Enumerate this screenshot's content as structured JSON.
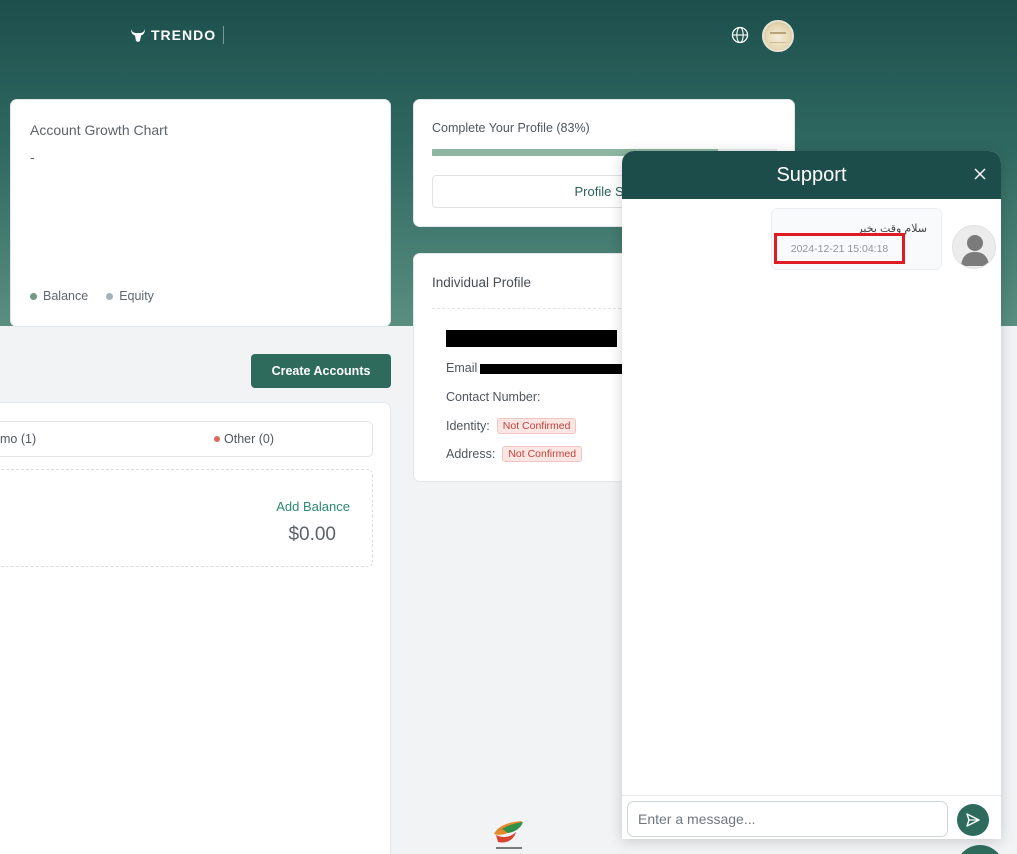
{
  "header": {
    "brand": "TRENDO"
  },
  "growth_chart": {
    "title": "Account Growth Chart",
    "value": "-",
    "legend": [
      {
        "label": "Balance",
        "color": "#6f9a86"
      },
      {
        "label": "Equity",
        "color": "#a7b2b6"
      }
    ]
  },
  "profile_completion": {
    "title": "Complete Your Profile (83%)",
    "percent": 83,
    "button_label": "Profile Set"
  },
  "individual_profile": {
    "title": "Individual Profile",
    "email_label": "Email",
    "contact_label": "Contact Number:",
    "identity_label": "Identity:",
    "identity_status": "Not Confirmed",
    "address_label": "Address:",
    "address_status": "Not Confirmed"
  },
  "accounts": {
    "create_button": "Create Accounts",
    "filter_demo": "mo (1)",
    "filter_other": "Other (0)",
    "add_balance": "Add Balance",
    "balance": "$0.00"
  },
  "support": {
    "title": "Support",
    "message_text": "سلام وقت بخیر",
    "message_time": "2024-12-21 15:04:18",
    "input_placeholder": "Enter a message..."
  },
  "colors": {
    "header_dark": "#1d4f4c",
    "accent": "#2f6b5d",
    "danger": "#c0433b",
    "highlight_box": "#e01b24"
  }
}
